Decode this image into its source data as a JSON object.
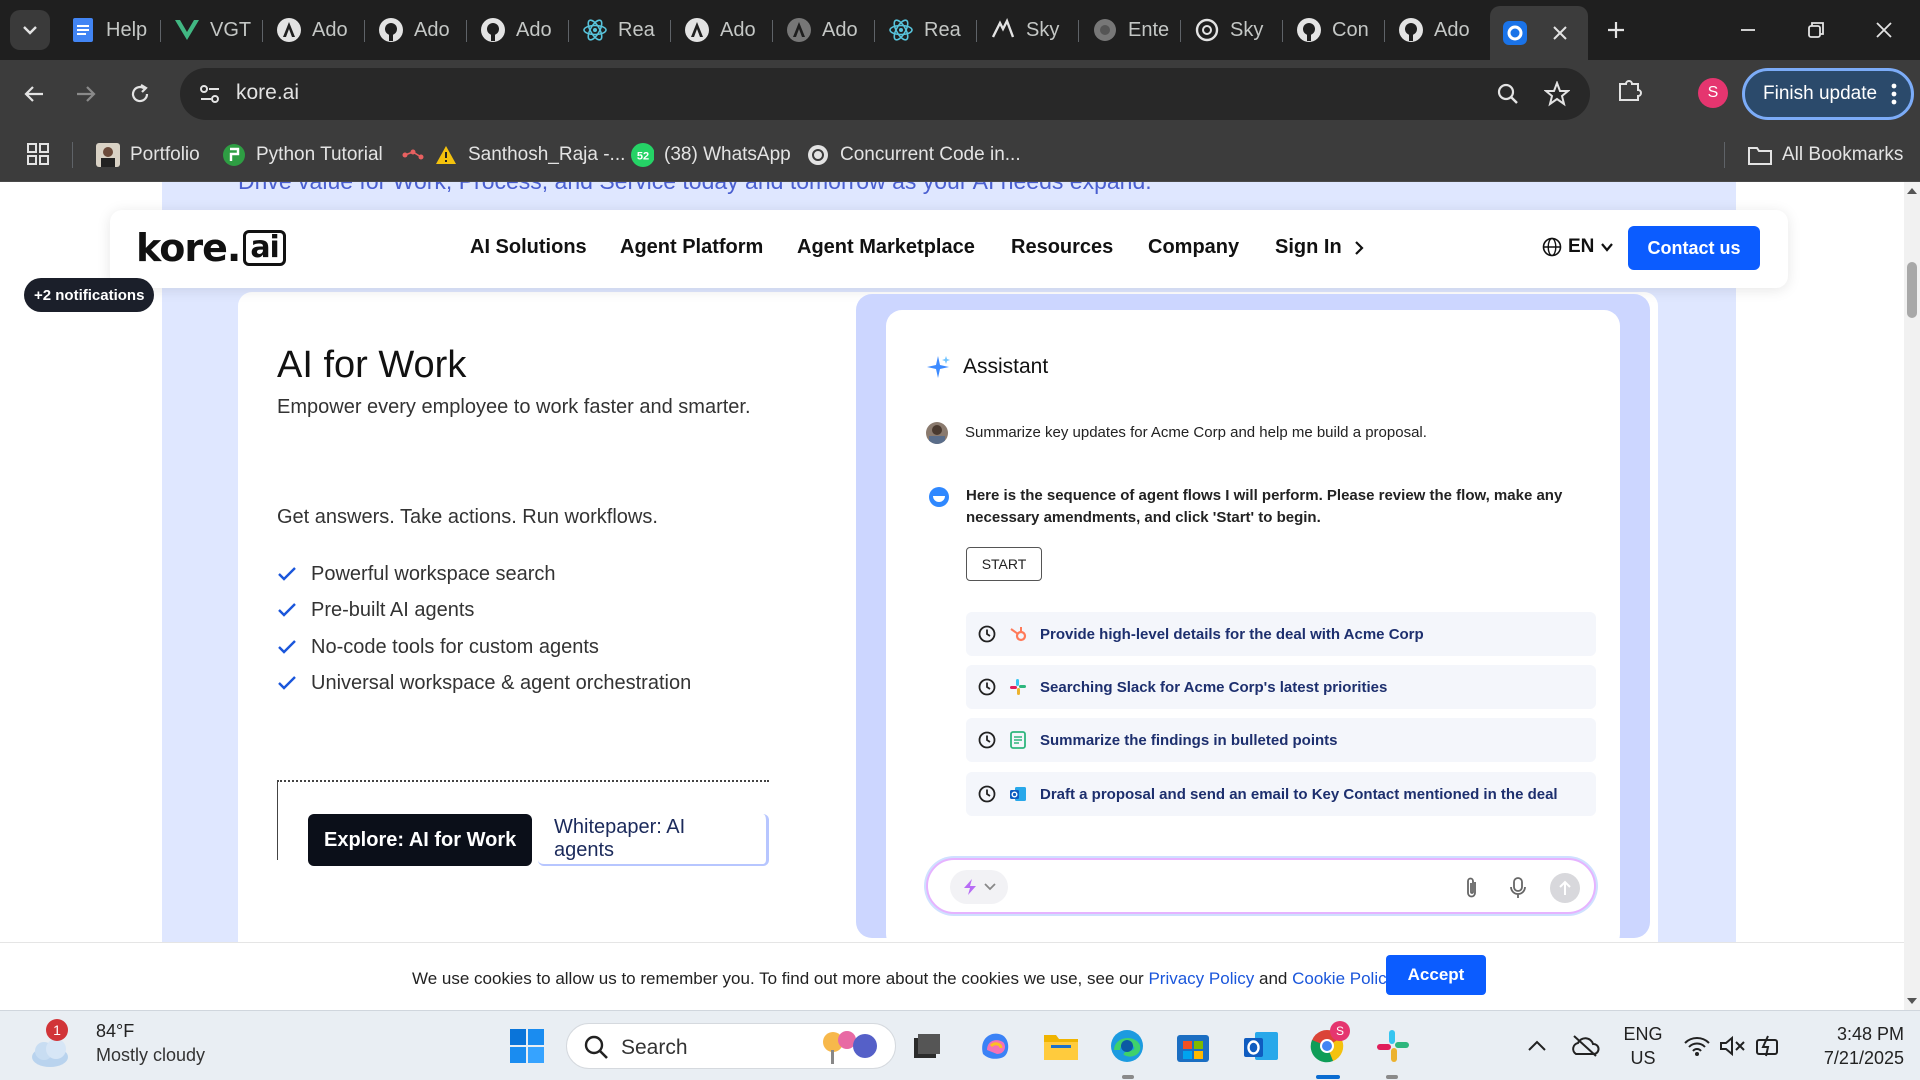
{
  "browser": {
    "tabs": [
      {
        "label": "Help",
        "icon": "docs-icon"
      },
      {
        "label": "VGT",
        "icon": "vue-icon"
      },
      {
        "label": "Ado",
        "icon": "angular-icon"
      },
      {
        "label": "Ado",
        "icon": "github-icon"
      },
      {
        "label": "Ado",
        "icon": "github-icon"
      },
      {
        "label": "Rea",
        "icon": "react-icon"
      },
      {
        "label": "Ado",
        "icon": "angular-icon"
      },
      {
        "label": "Ado",
        "icon": "angular-icon"
      },
      {
        "label": "Rea",
        "icon": "react-icon"
      },
      {
        "label": "Sky",
        "icon": "windsurf-icon"
      },
      {
        "label": "Ente",
        "icon": "globe-icon"
      },
      {
        "label": "Sky",
        "icon": "openai-icon"
      },
      {
        "label": "Con",
        "icon": "github-icon"
      },
      {
        "label": "Ado",
        "icon": "github-icon"
      }
    ],
    "url": "kore.ai",
    "profile_initial": "S",
    "update_label": "Finish update",
    "bookmarks": [
      {
        "label": "Portfolio"
      },
      {
        "label": "Python Tutorial"
      },
      {
        "label": "Santhosh_Raja -..."
      },
      {
        "label": "(38) WhatsApp"
      },
      {
        "label": "Concurrent Code in..."
      }
    ],
    "all_bookmarks": "All Bookmarks"
  },
  "page": {
    "hero_text": "Drive value for Work, Process, and Service today and tomorrow as your AI needs expand.",
    "nav": {
      "logo_main": "kore.",
      "logo_ai": "ai",
      "links": [
        "AI Solutions",
        "Agent Platform",
        "Agent Marketplace",
        "Resources",
        "Company",
        "Sign In"
      ],
      "lang": "EN",
      "contact": "Contact us"
    },
    "notifications": "+2 notifications",
    "title": "AI for Work",
    "subtitle": "Empower every employee to work faster and smarter.",
    "lead": "Get answers. Take actions. Run workflows.",
    "features": [
      "Powerful workspace search",
      "Pre-built AI agents",
      "No-code tools for custom agents",
      "Universal workspace & agent orchestration"
    ],
    "explore_btn": "Explore: AI for Work",
    "whitepaper_btn": "Whitepaper: AI agents",
    "assistant": {
      "title": "Assistant",
      "user_msg": "Summarize key updates for Acme Corp and help me build a proposal.",
      "bot_msg": "Here is the sequence of agent flows I will perform. Please review the flow, make any necessary amendments, and click 'Start' to begin.",
      "start": "START",
      "steps": [
        "Provide high-level details for the deal with Acme Corp",
        "Searching Slack for Acme Corp's latest priorities",
        "Summarize the findings in bulleted points",
        "Draft a proposal and send an email to Key Contact mentioned in the deal"
      ]
    },
    "cookie": {
      "text": "We use cookies to allow us to remember you. To find out more about the cookies we use, see our",
      "privacy": "Privacy Policy",
      "and": "and",
      "cookie_policy": "Cookie Policy",
      "accept": "Accept"
    }
  },
  "taskbar": {
    "weather_badge": "1",
    "temp": "84°F",
    "condition": "Mostly cloudy",
    "search": "Search",
    "lang_top": "ENG",
    "lang_bottom": "US",
    "time": "3:48 PM",
    "date": "7/21/2025",
    "chrome_badge": "S"
  },
  "colors": {
    "accent": "#0b5cff",
    "band": "#dfe7ff",
    "chrome_dark": "#1f1f1f"
  }
}
